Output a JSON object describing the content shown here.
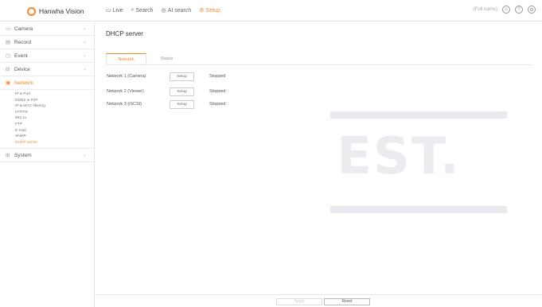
{
  "header": {
    "brand": "Hanwha Vision",
    "nav": [
      {
        "label": "Live",
        "icon": "monitor-icon",
        "glyph": "▭"
      },
      {
        "label": "Search",
        "icon": "search-icon",
        "glyph": "⌕"
      },
      {
        "label": "AI search",
        "icon": "ai-search-icon",
        "glyph": "◎"
      },
      {
        "label": "Setup",
        "icon": "gear-icon",
        "glyph": "⚙"
      }
    ],
    "user": "(Full name)",
    "icons": {
      "user": "☺",
      "help": "?",
      "settings": "⚙"
    }
  },
  "sidebar": {
    "items": [
      {
        "label": "Camera",
        "icon": "▭"
      },
      {
        "label": "Record",
        "icon": "▤"
      },
      {
        "label": "Event",
        "icon": "◫"
      },
      {
        "label": "Device",
        "icon": "⊟"
      },
      {
        "label": "Network",
        "icon": "▣"
      },
      {
        "label": "System",
        "icon": "⊞"
      }
    ],
    "network_sub": [
      "IP & Port",
      "DDNS & P2P",
      "IP & MAC filtering",
      "HTTPS",
      "802.1x",
      "FTP",
      "E-mail",
      "SNMP",
      "DHCP server"
    ],
    "chevron": "⌄"
  },
  "main": {
    "title": "DHCP server",
    "tabs": [
      "Network",
      "Status"
    ],
    "rows": [
      {
        "label": "Network 1 (Camera)",
        "button": "Setup",
        "status": "Stopped"
      },
      {
        "label": "Network 2 (Viewer)",
        "button": "Setup",
        "status": "Stopped"
      },
      {
        "label": "Network 3 (iSCSI)",
        "button": "Setup",
        "status": "Stopped"
      }
    ]
  },
  "footer": {
    "apply": "Apply",
    "reset": "Reset"
  },
  "watermark": {
    "text": "EST."
  },
  "colors": {
    "accent": "#f08c2e"
  }
}
